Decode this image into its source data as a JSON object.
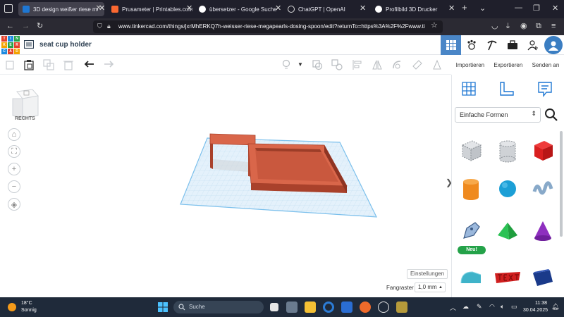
{
  "browser": {
    "tabs": [
      {
        "title": "3D design weißer riese mega",
        "active": true,
        "favicon_color": "#1e77d3"
      },
      {
        "title": "Prusameter | Printables.com",
        "active": false,
        "favicon_color": "#fa6831"
      },
      {
        "title": "übersetzer - Google Suche",
        "active": false,
        "favicon_color": "#ffffff"
      },
      {
        "title": "ChatGPT | OpenAI",
        "active": false,
        "favicon_color": "#1f1f2b"
      },
      {
        "title": "Profilbild 3D Drucker",
        "active": false,
        "favicon_color": "#ffffff"
      }
    ],
    "url": "www.tinkercad.com/things/jxrMhERKQ7h-weisser-riese-megapearls-dosing-spoon/edit?returnTo=https%3A%2F%2Fwww.ti"
  },
  "header": {
    "logo_letters": [
      "T",
      "I",
      "N",
      "K",
      "E",
      "R",
      "C",
      "A",
      "D"
    ],
    "design_title": "seat cup holder"
  },
  "actions": {
    "import": "Importieren",
    "export": "Exportieren",
    "send": "Senden an"
  },
  "viewport": {
    "viewcube_label": "RECHTS",
    "settings_label": "Einstellungen",
    "snap_label": "Fangraster",
    "snap_value": "1,0 mm"
  },
  "shapes_panel": {
    "category": "Einfache Formen",
    "new_badge": "Neu!",
    "shapes": [
      "box-hole",
      "cylinder-hole",
      "box",
      "cylinder",
      "sphere",
      "scribble",
      "text-and-numbers",
      "roof",
      "cone",
      "half-cylinder",
      "text",
      "polygon"
    ]
  },
  "taskbar": {
    "temperature": "18°C",
    "weather": "Sonnig",
    "search_placeholder": "Suche",
    "time": "11:38",
    "date": "30.04.2025"
  },
  "colors": {
    "tinkercad_blue": "#4a86c7",
    "model_face": "#d9664a",
    "model_side": "#a9412b",
    "workplane": "#e4f1fb",
    "new_badge": "#24a249"
  }
}
